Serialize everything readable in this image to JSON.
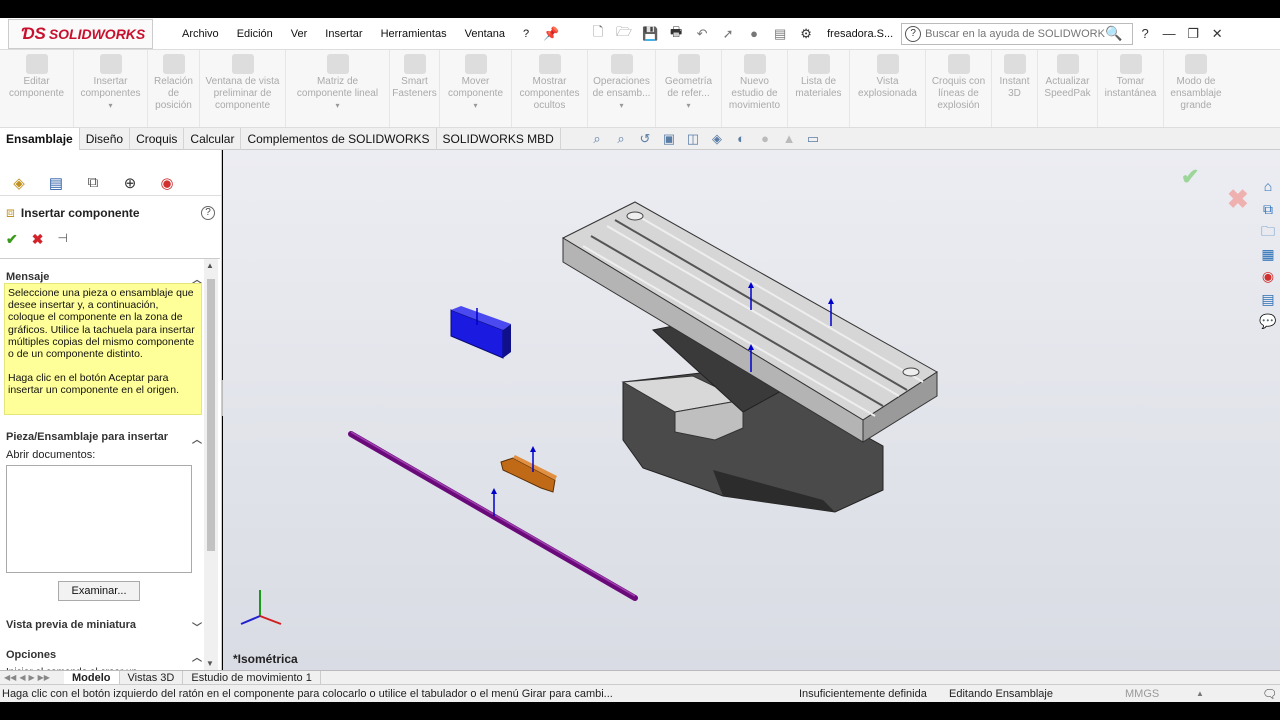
{
  "app": {
    "brand": "SOLIDWORKS",
    "doc_title": "fresadora.S..."
  },
  "menus": [
    "Archivo",
    "Edición",
    "Ver",
    "Insertar",
    "Herramientas",
    "Ventana",
    "?"
  ],
  "search": {
    "placeholder": "Buscar en la ayuda de SOLIDWORKS"
  },
  "ribbon": {
    "buttons": [
      "Editar componente",
      "Insertar componentes",
      "Relación de posición",
      "Ventana de vista preliminar de componente",
      "Matriz de componente lineal",
      "Smart Fasteners",
      "Mover componente",
      "Mostrar componentes ocultos",
      "Operaciones de ensamb...",
      "Geometría de refer...",
      "Nuevo estudio de movimiento",
      "Lista de materiales",
      "Vista explosionada",
      "Croquis con líneas de explosión",
      "Instant 3D",
      "Actualizar SpeedPak",
      "Tomar instantánea",
      "Modo de ensamblaje grande"
    ]
  },
  "tabs": [
    "Ensamblaje",
    "Diseño",
    "Croquis",
    "Calcular",
    "Complementos de SOLIDWORKS",
    "SOLIDWORKS MBD"
  ],
  "property_manager": {
    "title": "Insertar componente",
    "sections": {
      "message": "Mensaje",
      "part_assembly": "Pieza/Ensamblaje para insertar",
      "thumbnail": "Vista previa de miniatura",
      "options": "Opciones"
    },
    "message_p1": "Seleccione una pieza o ensamblaje que desee insertar y, a continuación, coloque el componente en la zona de gráficos. Utilice la tachuela para insertar múltiples copias del mismo componente o de un componente distinto.",
    "message_p2": "Haga clic en el botón Aceptar para insertar un componente en el origen.",
    "open_docs_label": "Abrir documentos:",
    "browse_button": "Examinar...",
    "option_partial": "Iniciar el comando al crear un"
  },
  "graphics": {
    "view_label": "*Isométrica",
    "colors": {
      "blue_block": "#1a1ae0",
      "rod": "#7a0a8a",
      "orange_part": "#d07820",
      "table": "#d4d4d4",
      "base": "#4a4a4a"
    }
  },
  "bottom_tabs": [
    "Modelo",
    "Vistas 3D",
    "Estudio de movimiento 1"
  ],
  "status": {
    "message": "Haga clic con el botón izquierdo del ratón en el componente para colocarlo o utilice el tabulador o el menú Girar para cambi...",
    "definition": "Insuficientemente definida",
    "mode": "Editando Ensamblaje",
    "units": "MMGS"
  }
}
